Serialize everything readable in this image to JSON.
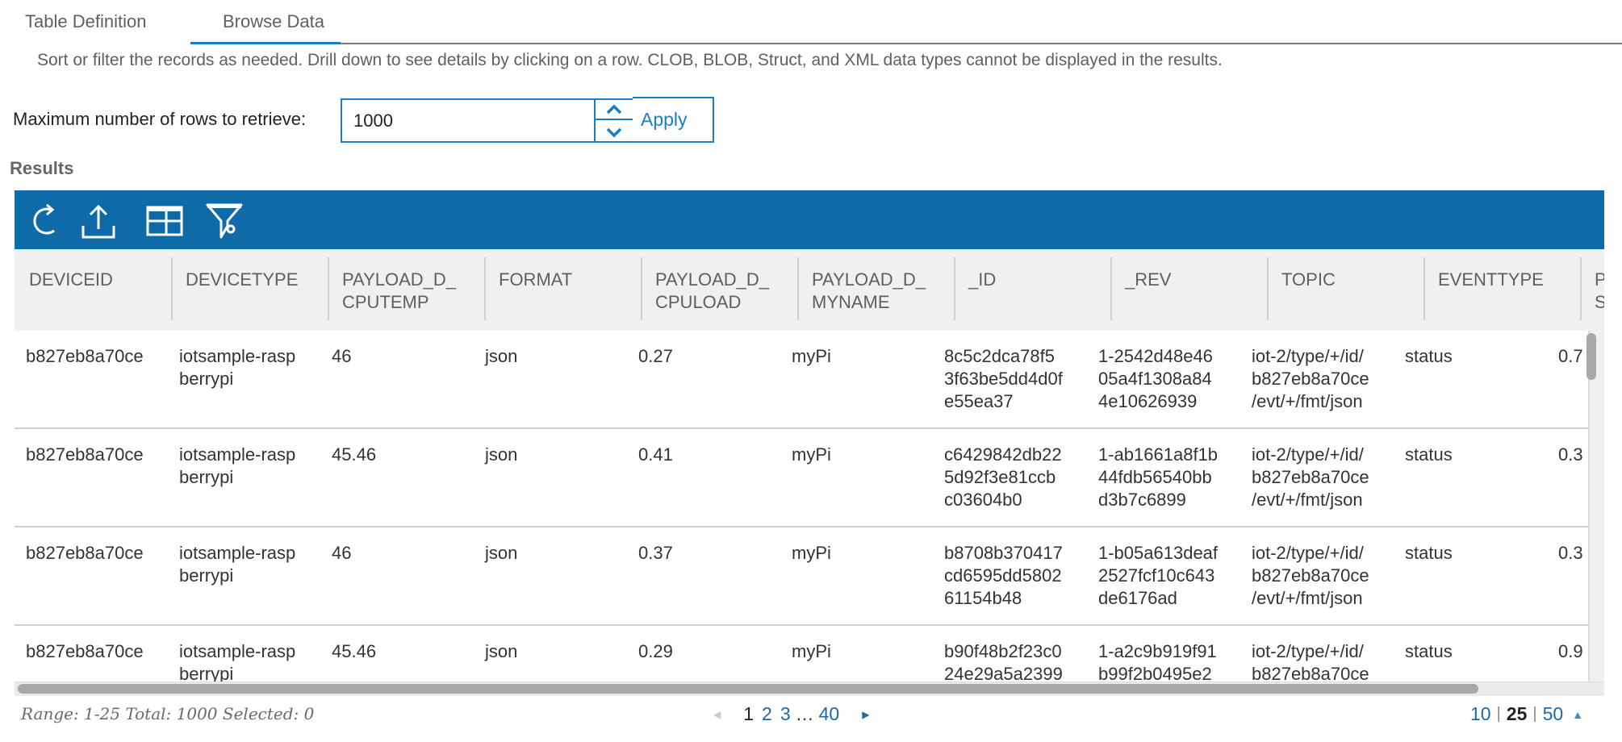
{
  "tabs": [
    {
      "label": "Table Definition",
      "active": false
    },
    {
      "label": "Browse Data",
      "active": true
    }
  ],
  "description": "Sort or filter the records as needed. Drill down to see details by clicking on a row. CLOB, BLOB, Struct, and XML data types cannot be displayed in the results.",
  "max_rows": {
    "label": "Maximum number of rows to retrieve:",
    "value": "1000",
    "apply_label": "Apply"
  },
  "results_title": "Results",
  "toolbar": {
    "icons": [
      "refresh-icon",
      "export-icon",
      "table-columns-icon",
      "filter-icon"
    ]
  },
  "colors": {
    "accent": "#1a7fc1",
    "toolbar_bg": "#0f6aa8",
    "header_bg": "#f0f0f0"
  },
  "table": {
    "columns": [
      "DEVICEID",
      "DEVICETYPE",
      "PAYLOAD_D_\nCPUTEMP",
      "FORMAT",
      "PAYLOAD_D_\nCPULOAD",
      "PAYLOAD_D_\nMYNAME",
      "_ID",
      "_REV",
      "TOPIC",
      "EVENTTYPE",
      "P\nS"
    ],
    "rows": [
      [
        "b827eb8a70ce",
        "iotsample-rasp\nberrypi",
        "46",
        "json",
        "0.27",
        "myPi",
        "8c5c2dca78f5\n3f63be5dd4d0f\ne55ea37",
        "1-2542d48e46\n05a4f1308a84\n4e10626939",
        "iot-2/type/+/id/\nb827eb8a70ce\n/evt/+/fmt/json",
        "status",
        "0.7"
      ],
      [
        "b827eb8a70ce",
        "iotsample-rasp\nberrypi",
        "45.46",
        "json",
        "0.41",
        "myPi",
        "c6429842db22\n5d92f3e81ccb\nc03604b0",
        "1-ab1661a8f1b\n44fdb56540bb\nd3b7c6899",
        "iot-2/type/+/id/\nb827eb8a70ce\n/evt/+/fmt/json",
        "status",
        "0.3"
      ],
      [
        "b827eb8a70ce",
        "iotsample-rasp\nberrypi",
        "46",
        "json",
        "0.37",
        "myPi",
        "b8708b370417\ncd6595dd5802\n61154b48",
        "1-b05a613deaf\n2527fcf10c643\nde6176ad",
        "iot-2/type/+/id/\nb827eb8a70ce\n/evt/+/fmt/json",
        "status",
        "0.3"
      ],
      [
        "b827eb8a70ce",
        "iotsample-rasp\nberrypi",
        "45.46",
        "json",
        "0.29",
        "myPi",
        "b90f48b2f23c0\n24e29a5a2399",
        "1-a2c9b919f91\nb99f2b0495e2",
        "iot-2/type/+/id/\nb827eb8a70ce",
        "status",
        "0.9"
      ]
    ]
  },
  "footer": {
    "range_text": "Range: 1-25 Total: 1000 Selected: 0",
    "pages": {
      "current": "1",
      "links": [
        "2",
        "3"
      ],
      "ellipsis": "…",
      "last": "40"
    },
    "page_sizes": {
      "options": [
        "10",
        "25",
        "50"
      ],
      "selected": "25",
      "separator": "|"
    }
  }
}
